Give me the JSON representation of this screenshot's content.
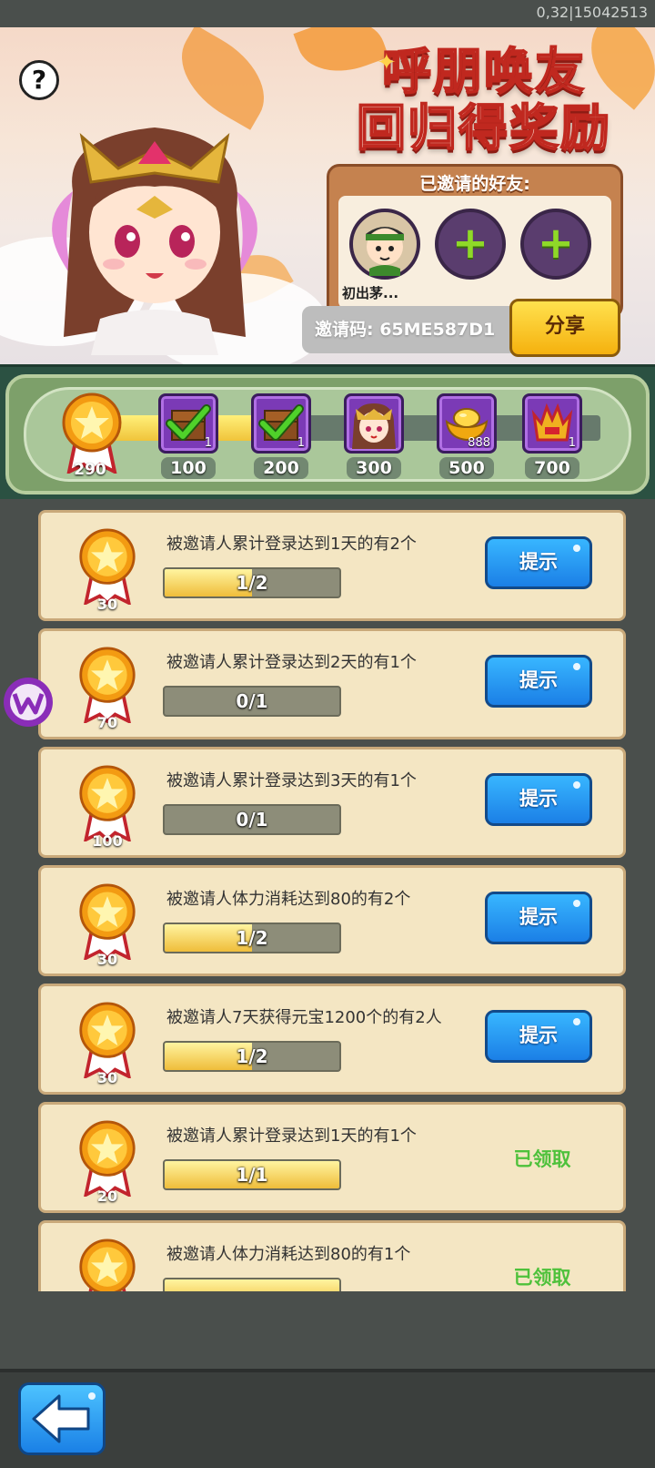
{
  "status_bar": {
    "id_text": "0,32|15042513"
  },
  "banner": {
    "help_label": "?",
    "title_line1": "呼朋唤友",
    "title_line2": "回归得奖励"
  },
  "invited_friends": {
    "title": "已邀请的好友:",
    "friend_name": "初出茅...",
    "empty_slot_symbol": "+"
  },
  "invite": {
    "code_label": "邀请码: 65ME587D1",
    "share_label": "分享"
  },
  "progress": {
    "points": "290",
    "progress_fraction": 0.33,
    "milestones": [
      {
        "value": "100",
        "count": "1",
        "icon": "chest-checked-icon"
      },
      {
        "value": "200",
        "count": "1",
        "icon": "chest-checked-icon"
      },
      {
        "value": "300",
        "count": "",
        "icon": "hero-portrait-icon"
      },
      {
        "value": "500",
        "count": "888",
        "icon": "gold-ingot-icon"
      },
      {
        "value": "700",
        "count": "1",
        "icon": "crown-icon"
      }
    ]
  },
  "tasks": [
    {
      "points": "30",
      "desc": "被邀请人累计登录达到1天的有2个",
      "progress": "1/2",
      "fraction": 0.5,
      "action": "提示",
      "claimed": false
    },
    {
      "points": "70",
      "desc": "被邀请人累计登录达到2天的有1个",
      "progress": "0/1",
      "fraction": 0,
      "action": "提示",
      "claimed": false
    },
    {
      "points": "100",
      "desc": "被邀请人累计登录达到3天的有1个",
      "progress": "0/1",
      "fraction": 0,
      "action": "提示",
      "claimed": false
    },
    {
      "points": "30",
      "desc": "被邀请人体力消耗达到80的有2个",
      "progress": "1/2",
      "fraction": 0.5,
      "action": "提示",
      "claimed": false
    },
    {
      "points": "30",
      "desc": "被邀请人7天获得元宝1200个的有2人",
      "progress": "1/2",
      "fraction": 0.5,
      "action": "提示",
      "claimed": false
    },
    {
      "points": "20",
      "desc": "被邀请人累计登录达到1天的有1个",
      "progress": "1/1",
      "fraction": 1,
      "action": "已领取",
      "claimed": true
    },
    {
      "points": "",
      "desc": "被邀请人体力消耗达到80的有1个",
      "progress": "",
      "fraction": 1,
      "action": "已领取",
      "claimed": true
    }
  ],
  "nav": {
    "back_icon": "back-arrow-icon"
  },
  "colors": {
    "hint_blue": "#1b7fe6",
    "claimed_green": "#4ec13b",
    "share_yellow": "#f5b10e"
  }
}
